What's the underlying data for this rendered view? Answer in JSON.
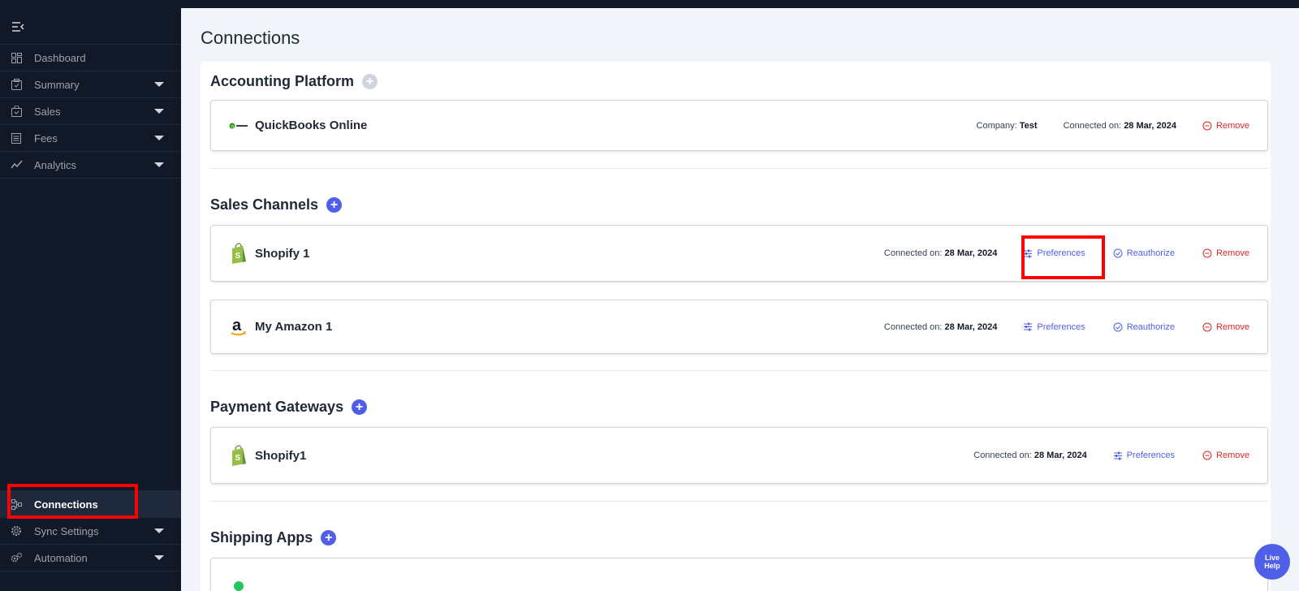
{
  "sidebar": {
    "items": [
      {
        "label": "Dashboard",
        "icon": "dashboard-icon",
        "caret": false
      },
      {
        "label": "Summary",
        "icon": "clipboard-icon",
        "caret": true
      },
      {
        "label": "Sales",
        "icon": "bag-icon",
        "caret": true
      },
      {
        "label": "Fees",
        "icon": "list-icon",
        "caret": true
      },
      {
        "label": "Analytics",
        "icon": "trend-icon",
        "caret": true
      }
    ],
    "bottom_items": [
      {
        "label": "Connections",
        "icon": "connections-icon",
        "active": true
      },
      {
        "label": "Sync Settings",
        "icon": "gear-icon",
        "caret": true
      },
      {
        "label": "Automation",
        "icon": "gears-icon",
        "caret": true
      }
    ]
  },
  "page": {
    "title": "Connections"
  },
  "sections": {
    "accounting": {
      "title": "Accounting Platform",
      "cards": [
        {
          "name": "QuickBooks Online",
          "company_label": "Company:",
          "company_value": "Test",
          "connected_label": "Connected on:",
          "connected_value": "28 Mar, 2024",
          "remove": "Remove"
        }
      ]
    },
    "sales": {
      "title": "Sales Channels",
      "cards": [
        {
          "name": "Shopify 1",
          "connected_label": "Connected on:",
          "connected_value": "28 Mar, 2024",
          "preferences": "Preferences",
          "reauthorize": "Reauthorize",
          "remove": "Remove"
        },
        {
          "name": "My Amazon 1",
          "connected_label": "Connected on:",
          "connected_value": "28 Mar, 2024",
          "preferences": "Preferences",
          "reauthorize": "Reauthorize",
          "remove": "Remove"
        }
      ]
    },
    "payment": {
      "title": "Payment Gateways",
      "cards": [
        {
          "name": "Shopify1",
          "connected_label": "Connected on:",
          "connected_value": "28 Mar, 2024",
          "preferences": "Preferences",
          "remove": "Remove"
        }
      ]
    },
    "shipping": {
      "title": "Shipping Apps"
    }
  },
  "live_help": {
    "line1": "Live",
    "line2": "Help"
  },
  "colors": {
    "accent": "#4f5fe8",
    "danger": "#dc2626",
    "highlight": "#ff0000",
    "sidebar": "#111827"
  }
}
